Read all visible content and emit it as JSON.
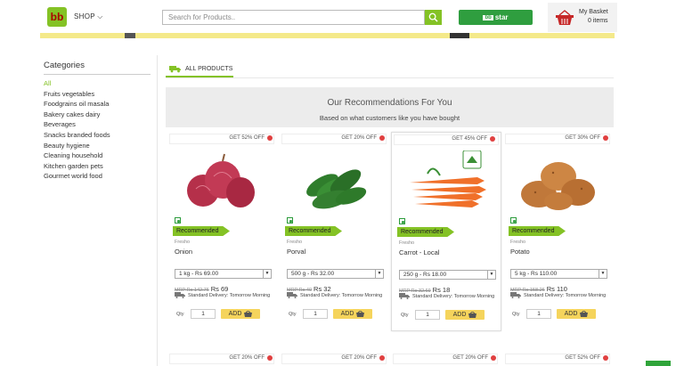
{
  "header": {
    "logo_text": "bb",
    "shop_label": "SHOP",
    "search_placeholder": "Search for Products..",
    "bbstar_label": "star",
    "basket_title": "My Basket",
    "basket_count": "0 items"
  },
  "sidebar": {
    "title": "Categories",
    "items": [
      {
        "label": "All",
        "active": true
      },
      {
        "label": "Fruits vegetables"
      },
      {
        "label": "Foodgrains oil masala"
      },
      {
        "label": "Bakery cakes dairy"
      },
      {
        "label": "Beverages"
      },
      {
        "label": "Snacks branded foods"
      },
      {
        "label": "Beauty hygiene"
      },
      {
        "label": "Cleaning household"
      },
      {
        "label": "Kitchen garden pets"
      },
      {
        "label": "Gourmet world food"
      }
    ]
  },
  "tab": {
    "label": "ALL PRODUCTS"
  },
  "reco": {
    "title": "Our Recommendations For You",
    "subtitle": "Based on what customers like you have bought"
  },
  "products": [
    {
      "offer": "GET 52% OFF",
      "tag": "Recommended",
      "brand": "Fresho",
      "name": "Onion",
      "variant": "1 kg - Rs 69.00",
      "mrp": "MRP Rs 142.76",
      "price": "Rs 69",
      "delivery": "Standard Delivery: Tomorrow Morning",
      "qty_label": "Qty",
      "qty": "1",
      "add": "ADD"
    },
    {
      "offer": "GET 20% OFF",
      "tag": "Recommended",
      "brand": "Fresho",
      "name": "Porval",
      "variant": "500 g - Rs 32.00",
      "mrp": "MRP Rs 40",
      "price": "Rs 32",
      "delivery": "Standard Delivery: Tomorrow Morning",
      "qty_label": "Qty",
      "qty": "1",
      "add": "ADD"
    },
    {
      "offer": "GET 45% OFF",
      "tag": "Recommended",
      "brand": "Fresho",
      "name": "Carrot - Local",
      "variant": "250 g - Rs 18.00",
      "mrp": "MRP Rs 32.69",
      "price": "Rs 18",
      "delivery": "Standard Delivery: Tomorrow Morning",
      "qty_label": "Qty",
      "qty": "1",
      "add": "ADD"
    },
    {
      "offer": "GET 30% OFF",
      "tag": "Recommended",
      "brand": "Fresho",
      "name": "Potato",
      "variant": "5 kg - Rs 110.00",
      "mrp": "MRP Rs 158.26",
      "price": "Rs 110",
      "delivery": "Standard Delivery: Tomorrow Morning",
      "qty_label": "Qty",
      "qty": "1",
      "add": "ADD"
    }
  ],
  "next_row_offers": [
    "GET 20% OFF",
    "GET 20% OFF",
    "GET 20% OFF",
    "GET 52% OFF"
  ],
  "colors": {
    "accent": "#84c225",
    "add_button": "#f5d45c",
    "offer_dot": "#e04040",
    "banner": "#f4e98a"
  }
}
